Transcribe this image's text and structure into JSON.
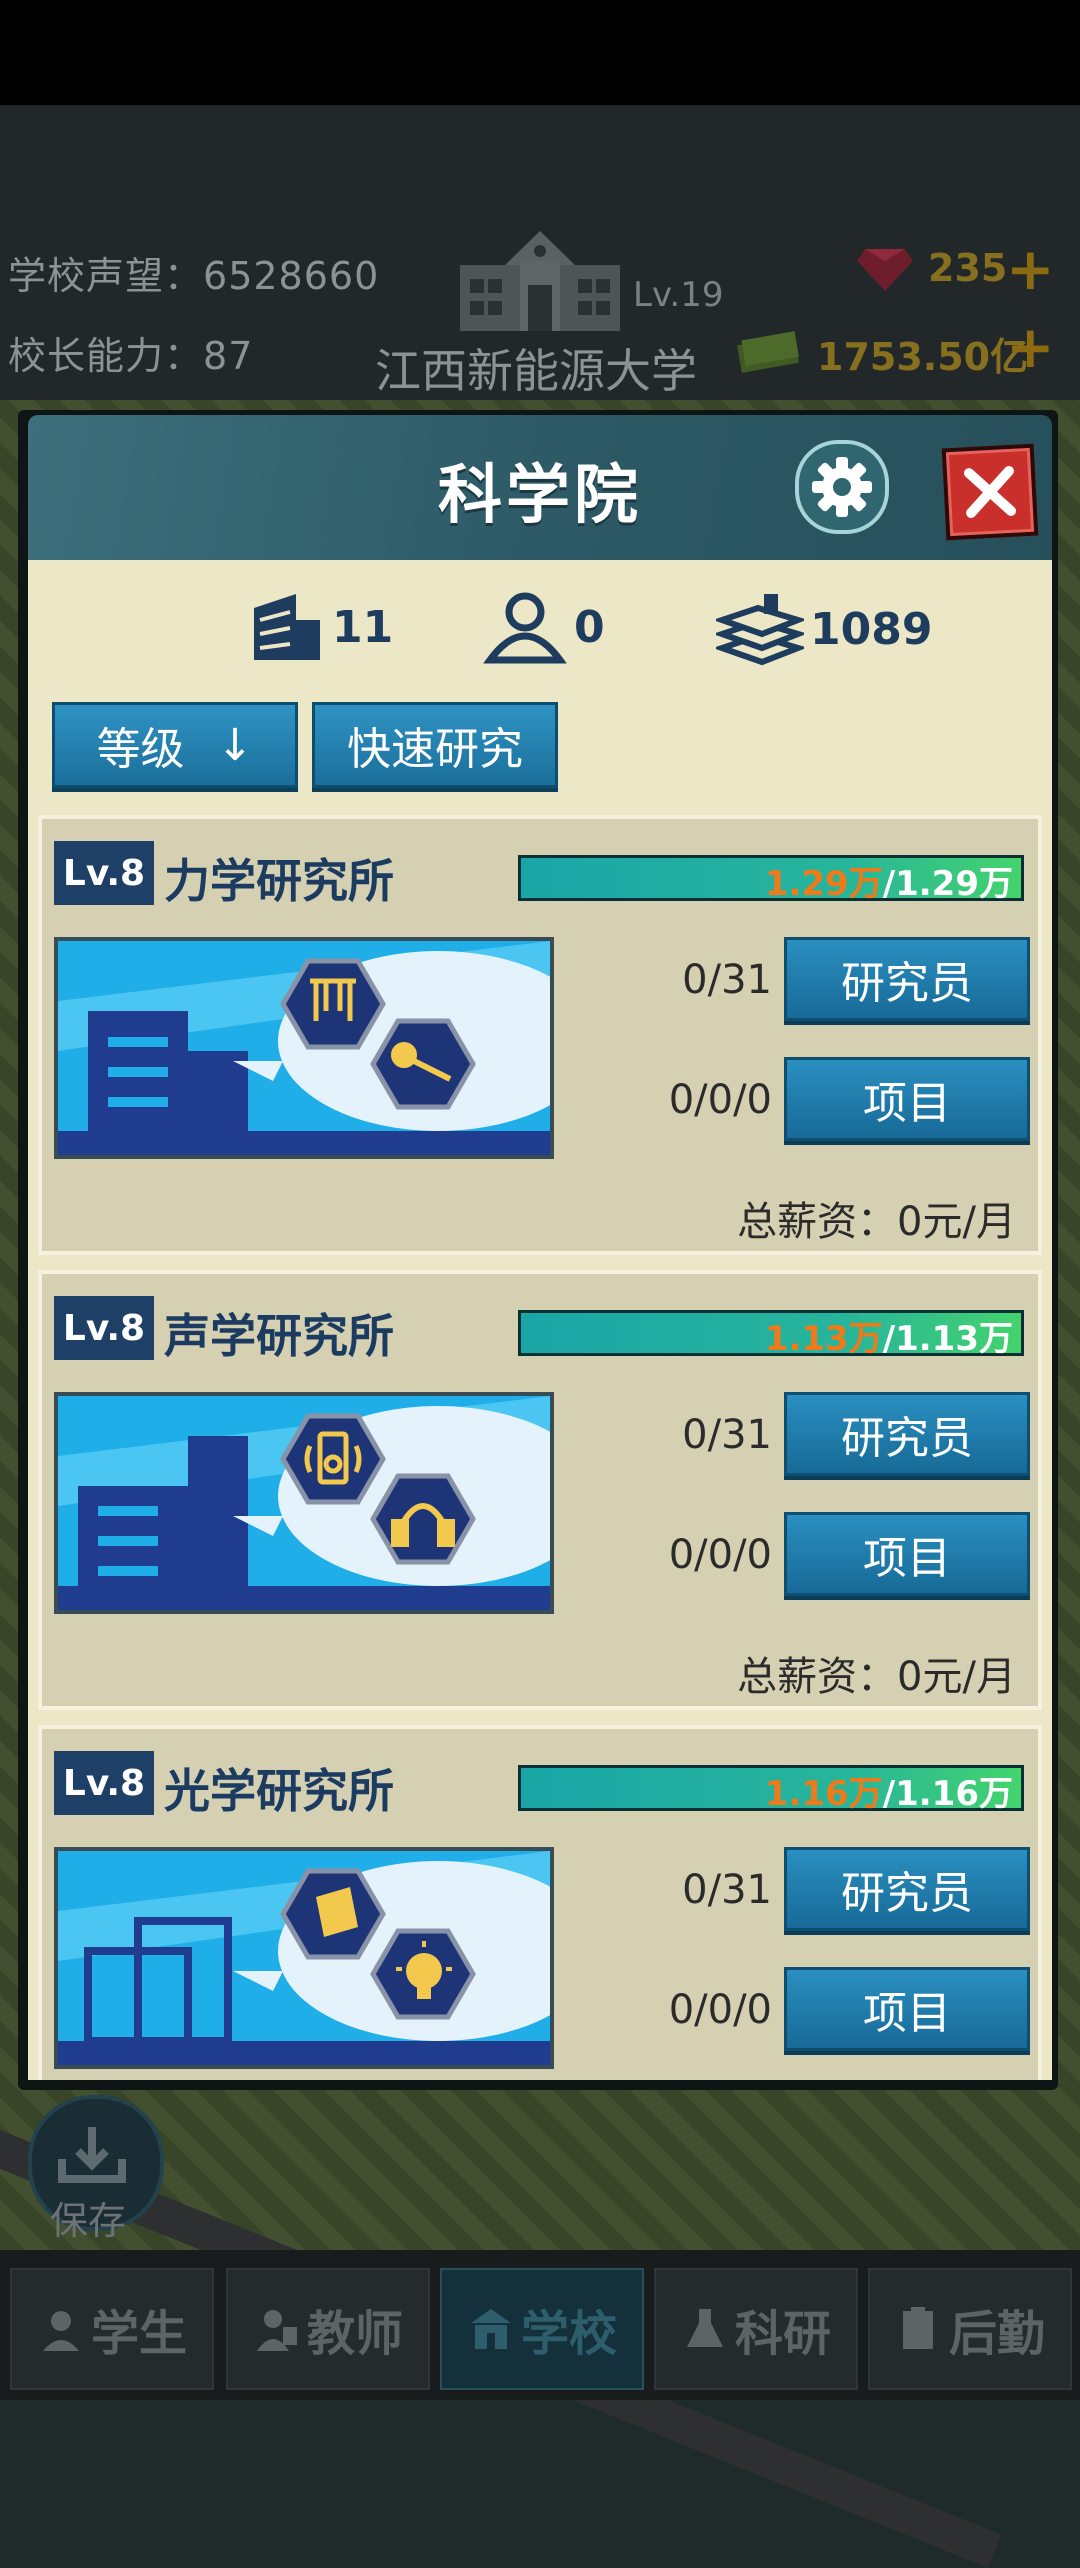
{
  "header": {
    "reputation_label": "学校声望：",
    "reputation_value": "6528660",
    "ability_label": "校长能力：",
    "ability_value": "87",
    "school_level": "Lv.19",
    "school_name": "江西新能源大学",
    "gems": "235",
    "money": "1753.50亿"
  },
  "modal": {
    "title": "科学院",
    "stats": {
      "buildings": "11",
      "people": "0",
      "books": "1089"
    },
    "sort_label": "等级",
    "sort_arrow": "↓",
    "quick_research_label": "快速研究"
  },
  "institutes": [
    {
      "level": "Lv.8",
      "name": "力学研究所",
      "progress_current": "1.29万",
      "progress_max": "/1.29万",
      "progress_fraction": 1.0,
      "researchers": "0/31",
      "researcher_btn": "研究员",
      "projects": "0/0/0",
      "project_btn": "项目",
      "salary": "总薪资：0元/月"
    },
    {
      "level": "Lv.8",
      "name": "声学研究所",
      "progress_current": "1.13万",
      "progress_max": "/1.13万",
      "progress_fraction": 1.0,
      "researchers": "0/31",
      "researcher_btn": "研究员",
      "projects": "0/0/0",
      "project_btn": "项目",
      "salary": "总薪资：0元/月"
    },
    {
      "level": "Lv.8",
      "name": "光学研究所",
      "progress_current": "1.16万",
      "progress_max": "/1.16万",
      "progress_fraction": 1.0,
      "researchers": "0/31",
      "researcher_btn": "研究员",
      "projects": "0/0/0",
      "project_btn": "项目",
      "salary": ""
    }
  ],
  "save_label": "保存",
  "nav": [
    {
      "label": "学生",
      "icon": "student-icon"
    },
    {
      "label": "教师",
      "icon": "teacher-icon"
    },
    {
      "label": "学校",
      "icon": "school-icon",
      "active": true
    },
    {
      "label": "科研",
      "icon": "flask-icon"
    },
    {
      "label": "后勤",
      "icon": "clipboard-icon"
    }
  ],
  "colors": {
    "accent_blue": "#1b6f9b",
    "progress_green": "#44d36c",
    "progress_orange": "#f07a1a",
    "close_red": "#c9302c"
  }
}
